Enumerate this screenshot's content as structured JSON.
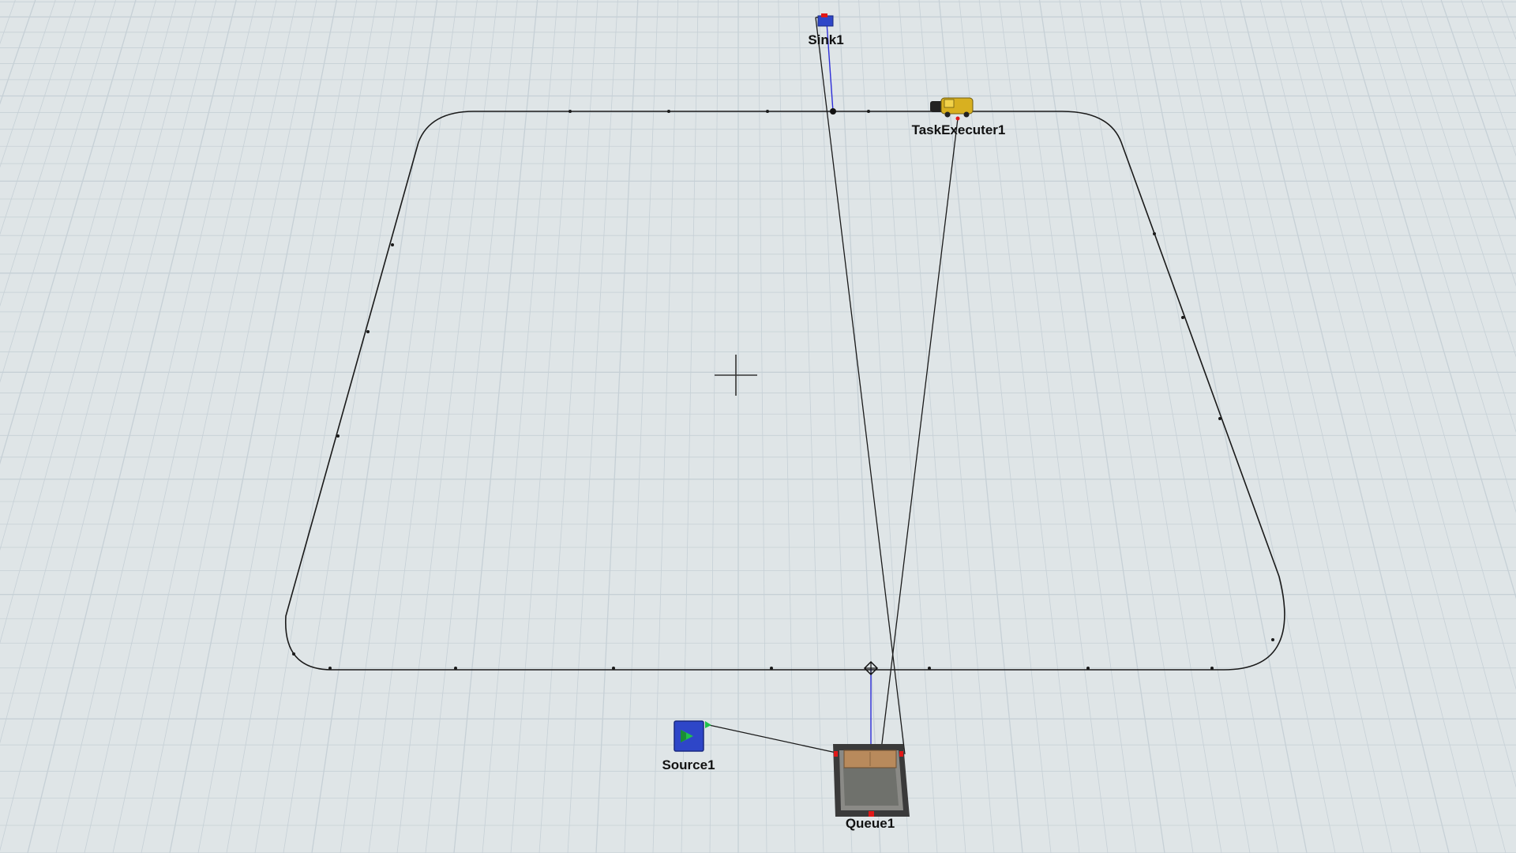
{
  "colors": {
    "background": "#dfe5e7",
    "grid_line": "#c6d0d6",
    "path_line": "#1a1a1a",
    "connection_line": "#1a1a1a",
    "center_port_line": "#2d2dd8",
    "source_body": "#2e46c8",
    "source_arrow": "#21c24a",
    "port_red": "#e01818",
    "queue_frame": "#3a3a3a",
    "queue_floor": "#8a8a86",
    "queue_backwall": "#b88a5c",
    "truck_body": "#d8b020"
  },
  "objects": {
    "sink": {
      "label": "Sink1",
      "icon": "sink-icon"
    },
    "task_executer": {
      "label": "TaskExecuter1",
      "icon": "truck-icon"
    },
    "source": {
      "label": "Source1",
      "icon": "source-icon"
    },
    "queue": {
      "label": "Queue1",
      "icon": "queue-icon"
    }
  },
  "view": {
    "crosshair_icon": "crosshair-icon",
    "network_node_icon": "network-node-icon"
  }
}
